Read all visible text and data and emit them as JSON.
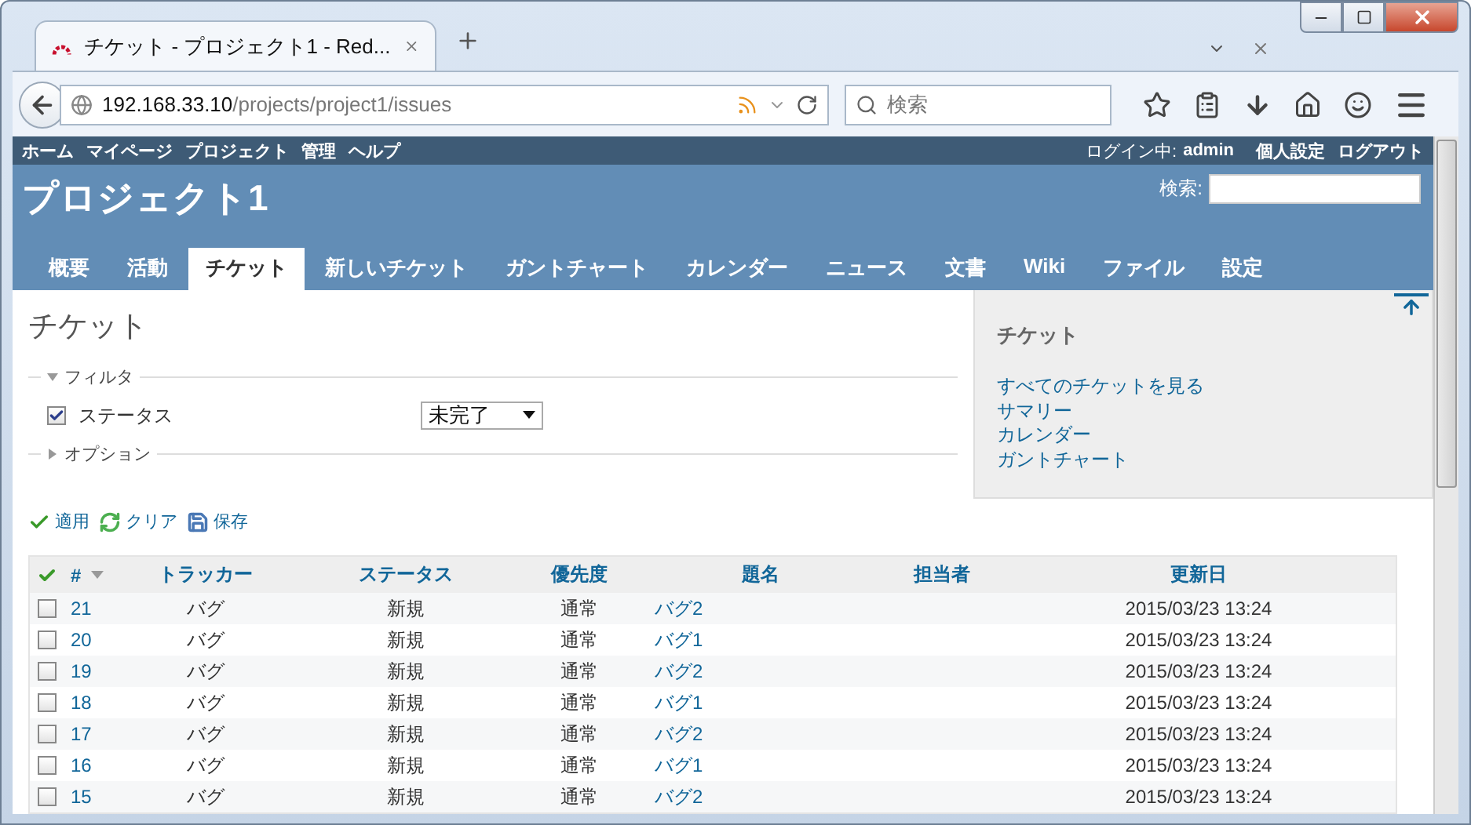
{
  "browser": {
    "tab_title": "チケット - プロジェクト1 - Red...",
    "url_host": "192.168.33.10",
    "url_path": "/projects/project1/issues",
    "search_placeholder": "検索"
  },
  "top_menu": [
    "ホーム",
    "マイページ",
    "プロジェクト",
    "管理",
    "ヘルプ"
  ],
  "account": {
    "logged_in_label": "ログイン中:",
    "user": "admin",
    "links": [
      "個人設定",
      "ログアウト"
    ]
  },
  "project_title": "プロジェクト1",
  "search_label": "検索:",
  "tabs": [
    {
      "label": "概要",
      "selected": false
    },
    {
      "label": "活動",
      "selected": false
    },
    {
      "label": "チケット",
      "selected": true
    },
    {
      "label": "新しいチケット",
      "selected": false
    },
    {
      "label": "ガントチャート",
      "selected": false
    },
    {
      "label": "カレンダー",
      "selected": false
    },
    {
      "label": "ニュース",
      "selected": false
    },
    {
      "label": "文書",
      "selected": false
    },
    {
      "label": "Wiki",
      "selected": false
    },
    {
      "label": "ファイル",
      "selected": false
    },
    {
      "label": "設定",
      "selected": false
    }
  ],
  "page_title": "チケット",
  "filter": {
    "legend": "フィルタ",
    "expanded": true,
    "rows": [
      {
        "label": "ステータス",
        "checked": true,
        "value": "未完了"
      }
    ]
  },
  "options": {
    "legend": "オプション",
    "expanded": false
  },
  "actions": [
    "適用",
    "クリア",
    "保存"
  ],
  "table": {
    "columns": [
      "#",
      "トラッカー",
      "ステータス",
      "優先度",
      "題名",
      "担当者",
      "更新日"
    ],
    "rows": [
      {
        "id": "21",
        "tracker": "バグ",
        "status": "新規",
        "priority": "通常",
        "subject": "バグ2",
        "updated": "2015/03/23 13:24",
        "checked": false
      },
      {
        "id": "20",
        "tracker": "バグ",
        "status": "新規",
        "priority": "通常",
        "subject": "バグ1",
        "updated": "2015/03/23 13:24",
        "checked": false
      },
      {
        "id": "19",
        "tracker": "バグ",
        "status": "新規",
        "priority": "通常",
        "subject": "バグ2",
        "updated": "2015/03/23 13:24",
        "checked": false
      },
      {
        "id": "18",
        "tracker": "バグ",
        "status": "新規",
        "priority": "通常",
        "subject": "バグ1",
        "updated": "2015/03/23 13:24",
        "checked": false
      },
      {
        "id": "17",
        "tracker": "バグ",
        "status": "新規",
        "priority": "通常",
        "subject": "バグ2",
        "updated": "2015/03/23 13:24",
        "checked": false
      },
      {
        "id": "16",
        "tracker": "バグ",
        "status": "新規",
        "priority": "通常",
        "subject": "バグ1",
        "updated": "2015/03/23 13:24",
        "checked": false
      },
      {
        "id": "15",
        "tracker": "バグ",
        "status": "新規",
        "priority": "通常",
        "subject": "バグ2",
        "updated": "2015/03/23 13:24",
        "checked": false
      }
    ]
  },
  "sidebar": {
    "title": "チケット",
    "links": [
      "すべてのチケットを見る",
      "サマリー",
      "カレンダー",
      "ガントチャート"
    ]
  }
}
